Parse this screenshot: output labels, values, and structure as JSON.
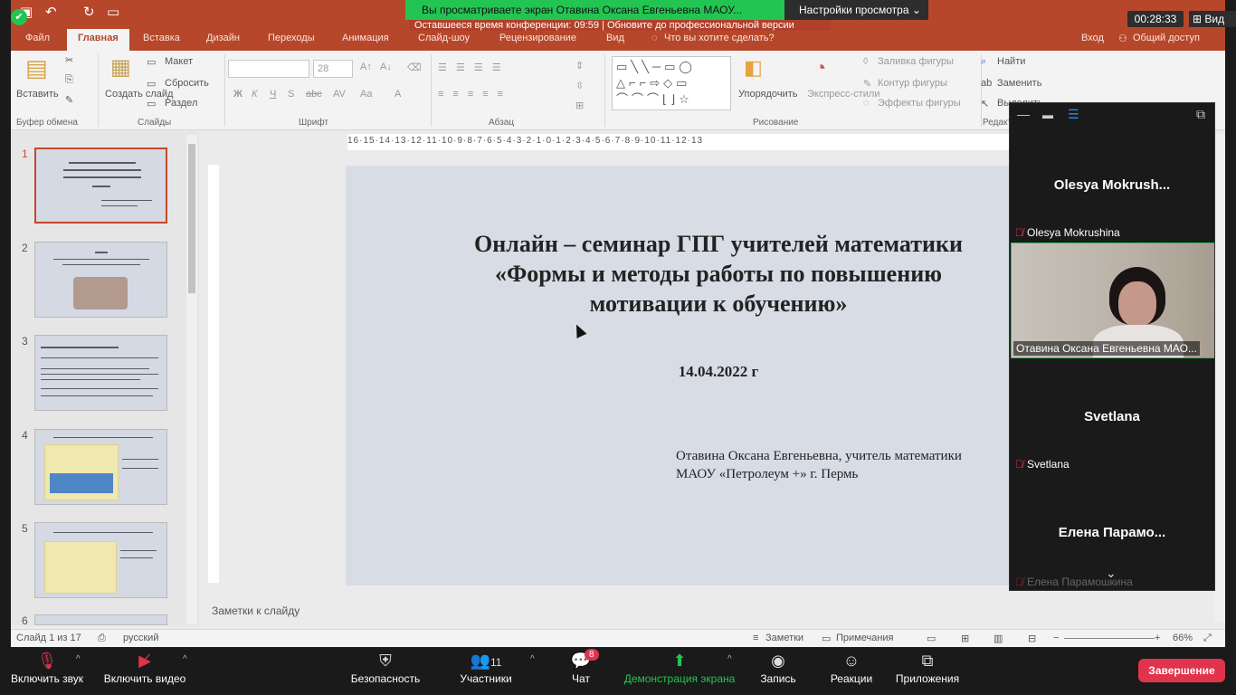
{
  "zoom": {
    "share_banner": "Вы просматриваете экран Отавина Оксана Евгеньевна МАОУ...",
    "view_settings": "Настройки просмотра",
    "conference_notice": "Оставшееся время конференции: 09:59 | Обновите до профессиональной версии",
    "timer": "00:28:33",
    "view_button": "Вид",
    "participants": [
      {
        "big_name": "Olesya  Mokrush...",
        "label": "Olesya Mokrushina",
        "muted": true,
        "video": false
      },
      {
        "big_name": "",
        "label": "Отавина Оксана Евгеньевна МАО...",
        "muted": false,
        "video": true
      },
      {
        "big_name": "Svetlana",
        "label": "Svetlana",
        "muted": true,
        "video": false
      },
      {
        "big_name": "Елена  Парамо...",
        "label": "Елена Парамошкина",
        "muted": true,
        "video": false
      }
    ],
    "toolbar": {
      "unmute": "Включить звук",
      "start_video": "Включить видео",
      "security": "Безопасность",
      "participants": "Участники",
      "participants_count": "11",
      "chat": "Чат",
      "chat_badge": "8",
      "share_screen": "Демонстрация экрана",
      "record": "Запись",
      "reactions": "Реакции",
      "apps": "Приложения",
      "end": "Завершение"
    }
  },
  "ppt": {
    "tabs": [
      "Файл",
      "Главная",
      "Вставка",
      "Дизайн",
      "Переходы",
      "Анимация",
      "Слайд-шоу",
      "Рецензирование",
      "Вид"
    ],
    "tell_me": "Что вы хотите сделать?",
    "sign_in": "Вход",
    "share": "Общий доступ",
    "ribbon": {
      "paste": "Вставить",
      "clipboard": "Буфер обмена",
      "new_slide": "Создать слайд",
      "layout": "Макет",
      "reset": "Сбросить",
      "section": "Раздел",
      "slides_group": "Слайды",
      "font_size": "28",
      "font_group": "Шрифт",
      "paragraph_group": "Абзац",
      "arrange": "Упорядочить",
      "quick_styles": "Экспресс-стили",
      "fill": "Заливка фигуры",
      "outline": "Контур фигуры",
      "effects": "Эффекты фигуры",
      "drawing_group": "Рисование",
      "find": "Найти",
      "replace": "Заменить",
      "select": "Выделить",
      "editing_group": "Редакти..."
    },
    "ruler_text": "16·15·14·13·12·11·10·9·8·7·6·5·4·3·2·1·0·1·2·3·4·5·6·7·8·9·10·11·12·13",
    "thumbnails": [
      "1",
      "2",
      "3",
      "4",
      "5",
      "6"
    ],
    "slide": {
      "title": "Онлайн – семинар ГПГ учителей математики «Формы и методы работы по повышению мотивации к обучению»",
      "date": "14.04.2022 г",
      "author_line1": "Отавина Оксана Евгеньевна, учитель математики",
      "author_line2": "МАОУ «Петролеум +» г. Пермь"
    },
    "notes_placeholder": "Заметки к слайду",
    "status": {
      "slide_count": "Слайд 1 из 17",
      "language": "русский",
      "notes": "Заметки",
      "comments": "Примечания",
      "zoom": "66%"
    }
  }
}
